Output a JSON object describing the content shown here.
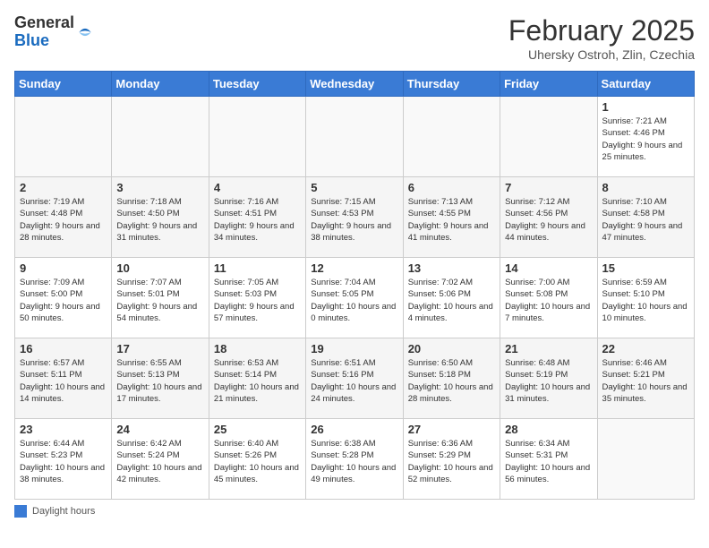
{
  "header": {
    "logo_line1": "General",
    "logo_line2": "Blue",
    "month_title": "February 2025",
    "subtitle": "Uhersky Ostroh, Zlin, Czechia"
  },
  "weekdays": [
    "Sunday",
    "Monday",
    "Tuesday",
    "Wednesday",
    "Thursday",
    "Friday",
    "Saturday"
  ],
  "weeks": [
    [
      {
        "day": "",
        "info": ""
      },
      {
        "day": "",
        "info": ""
      },
      {
        "day": "",
        "info": ""
      },
      {
        "day": "",
        "info": ""
      },
      {
        "day": "",
        "info": ""
      },
      {
        "day": "",
        "info": ""
      },
      {
        "day": "1",
        "info": "Sunrise: 7:21 AM\nSunset: 4:46 PM\nDaylight: 9 hours and 25 minutes."
      }
    ],
    [
      {
        "day": "2",
        "info": "Sunrise: 7:19 AM\nSunset: 4:48 PM\nDaylight: 9 hours and 28 minutes."
      },
      {
        "day": "3",
        "info": "Sunrise: 7:18 AM\nSunset: 4:50 PM\nDaylight: 9 hours and 31 minutes."
      },
      {
        "day": "4",
        "info": "Sunrise: 7:16 AM\nSunset: 4:51 PM\nDaylight: 9 hours and 34 minutes."
      },
      {
        "day": "5",
        "info": "Sunrise: 7:15 AM\nSunset: 4:53 PM\nDaylight: 9 hours and 38 minutes."
      },
      {
        "day": "6",
        "info": "Sunrise: 7:13 AM\nSunset: 4:55 PM\nDaylight: 9 hours and 41 minutes."
      },
      {
        "day": "7",
        "info": "Sunrise: 7:12 AM\nSunset: 4:56 PM\nDaylight: 9 hours and 44 minutes."
      },
      {
        "day": "8",
        "info": "Sunrise: 7:10 AM\nSunset: 4:58 PM\nDaylight: 9 hours and 47 minutes."
      }
    ],
    [
      {
        "day": "9",
        "info": "Sunrise: 7:09 AM\nSunset: 5:00 PM\nDaylight: 9 hours and 50 minutes."
      },
      {
        "day": "10",
        "info": "Sunrise: 7:07 AM\nSunset: 5:01 PM\nDaylight: 9 hours and 54 minutes."
      },
      {
        "day": "11",
        "info": "Sunrise: 7:05 AM\nSunset: 5:03 PM\nDaylight: 9 hours and 57 minutes."
      },
      {
        "day": "12",
        "info": "Sunrise: 7:04 AM\nSunset: 5:05 PM\nDaylight: 10 hours and 0 minutes."
      },
      {
        "day": "13",
        "info": "Sunrise: 7:02 AM\nSunset: 5:06 PM\nDaylight: 10 hours and 4 minutes."
      },
      {
        "day": "14",
        "info": "Sunrise: 7:00 AM\nSunset: 5:08 PM\nDaylight: 10 hours and 7 minutes."
      },
      {
        "day": "15",
        "info": "Sunrise: 6:59 AM\nSunset: 5:10 PM\nDaylight: 10 hours and 10 minutes."
      }
    ],
    [
      {
        "day": "16",
        "info": "Sunrise: 6:57 AM\nSunset: 5:11 PM\nDaylight: 10 hours and 14 minutes."
      },
      {
        "day": "17",
        "info": "Sunrise: 6:55 AM\nSunset: 5:13 PM\nDaylight: 10 hours and 17 minutes."
      },
      {
        "day": "18",
        "info": "Sunrise: 6:53 AM\nSunset: 5:14 PM\nDaylight: 10 hours and 21 minutes."
      },
      {
        "day": "19",
        "info": "Sunrise: 6:51 AM\nSunset: 5:16 PM\nDaylight: 10 hours and 24 minutes."
      },
      {
        "day": "20",
        "info": "Sunrise: 6:50 AM\nSunset: 5:18 PM\nDaylight: 10 hours and 28 minutes."
      },
      {
        "day": "21",
        "info": "Sunrise: 6:48 AM\nSunset: 5:19 PM\nDaylight: 10 hours and 31 minutes."
      },
      {
        "day": "22",
        "info": "Sunrise: 6:46 AM\nSunset: 5:21 PM\nDaylight: 10 hours and 35 minutes."
      }
    ],
    [
      {
        "day": "23",
        "info": "Sunrise: 6:44 AM\nSunset: 5:23 PM\nDaylight: 10 hours and 38 minutes."
      },
      {
        "day": "24",
        "info": "Sunrise: 6:42 AM\nSunset: 5:24 PM\nDaylight: 10 hours and 42 minutes."
      },
      {
        "day": "25",
        "info": "Sunrise: 6:40 AM\nSunset: 5:26 PM\nDaylight: 10 hours and 45 minutes."
      },
      {
        "day": "26",
        "info": "Sunrise: 6:38 AM\nSunset: 5:28 PM\nDaylight: 10 hours and 49 minutes."
      },
      {
        "day": "27",
        "info": "Sunrise: 6:36 AM\nSunset: 5:29 PM\nDaylight: 10 hours and 52 minutes."
      },
      {
        "day": "28",
        "info": "Sunrise: 6:34 AM\nSunset: 5:31 PM\nDaylight: 10 hours and 56 minutes."
      },
      {
        "day": "",
        "info": ""
      }
    ]
  ],
  "legend": {
    "box_label": "Daylight hours"
  }
}
